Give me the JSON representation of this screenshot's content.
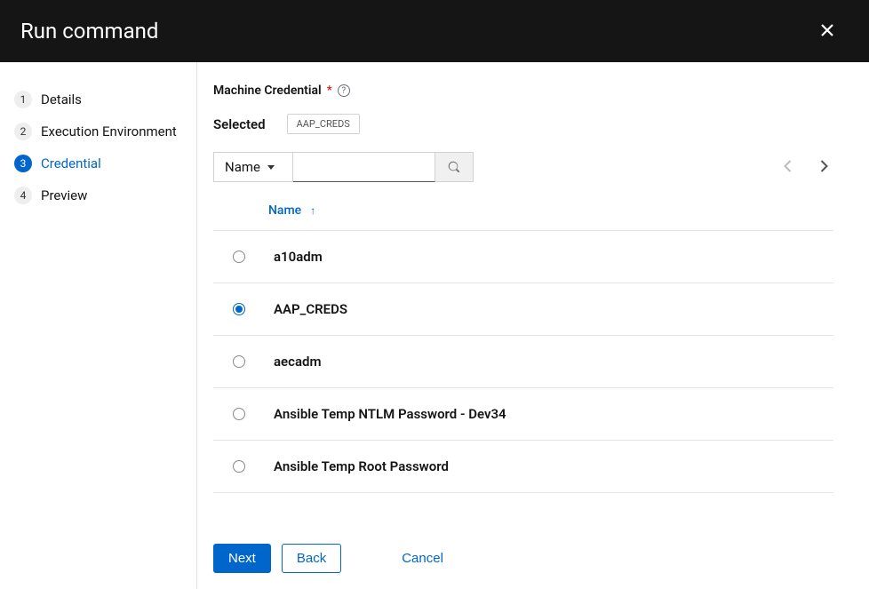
{
  "modal": {
    "title": "Run command"
  },
  "wizard": {
    "steps": [
      {
        "num": "1",
        "label": "Details"
      },
      {
        "num": "2",
        "label": "Execution Environment"
      },
      {
        "num": "3",
        "label": "Credential"
      },
      {
        "num": "4",
        "label": "Preview"
      }
    ],
    "active_index": 2
  },
  "field": {
    "label": "Machine Credential"
  },
  "selected": {
    "label": "Selected",
    "chip": "AAP_CREDS"
  },
  "search": {
    "filter_label": "Name",
    "input_value": ""
  },
  "table": {
    "column": "Name"
  },
  "credentials": [
    {
      "name": "a10adm",
      "checked": false
    },
    {
      "name": "AAP_CREDS",
      "checked": true
    },
    {
      "name": "aecadm",
      "checked": false
    },
    {
      "name": "Ansible Temp NTLM Password - Dev34",
      "checked": false
    },
    {
      "name": "Ansible Temp Root Password",
      "checked": false
    }
  ],
  "footer": {
    "next": "Next",
    "back": "Back",
    "cancel": "Cancel"
  }
}
